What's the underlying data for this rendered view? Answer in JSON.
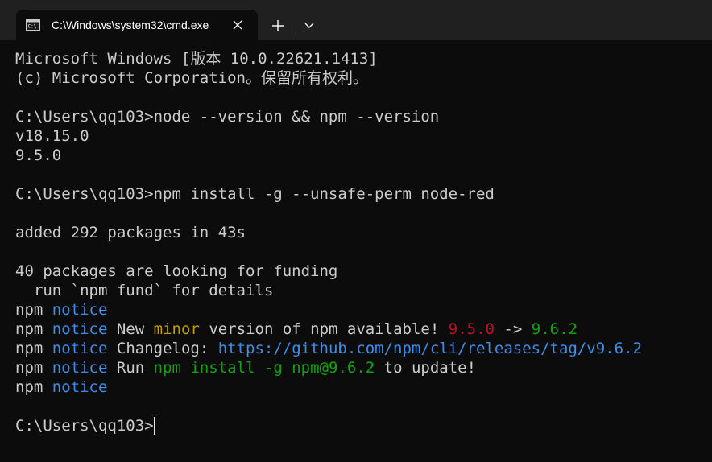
{
  "colors": {
    "background": "#0c0c0c",
    "tabbar": "#202020",
    "text": "#cccccc",
    "blue": "#3b8eea",
    "yellow": "#c19c00",
    "red": "#c50f1f",
    "green": "#13a10e"
  },
  "tab": {
    "icon": "cmd-icon",
    "title": "C:\\Windows\\system32\\cmd.exe",
    "close_icon": "close-icon",
    "new_tab_icon": "plus-icon",
    "dropdown_icon": "chevron-down-icon"
  },
  "terminal": {
    "header": {
      "line1": "Microsoft Windows [版本 10.0.22621.1413]",
      "line2": "(c) Microsoft Corporation。保留所有权利。"
    },
    "cmd1": {
      "prompt": "C:\\Users\\qq103>",
      "command": "node --version && npm --version"
    },
    "node_version": "v18.15.0",
    "npm_version": "9.5.0",
    "cmd2": {
      "prompt": "C:\\Users\\qq103>",
      "command": "npm install -g --unsafe-perm node-red"
    },
    "added": "added 292 packages in 43s",
    "funding1": "40 packages are looking for funding",
    "funding2": "  run `npm fund` for details",
    "notices": {
      "npm": "npm",
      "notice": "notice",
      "new_label": "New",
      "minor": "minor",
      "version_text": "version of npm available!",
      "old_version": "9.5.0",
      "arrow": "->",
      "new_version": "9.6.2",
      "changelog_label": "Changelog:",
      "changelog_url": "https://github.com/npm/cli/releases/tag/v9.6.2",
      "run_label": "Run",
      "run_command": "npm install -g npm@9.6.2",
      "run_suffix": "to update!"
    },
    "final_prompt": "C:\\Users\\qq103>"
  }
}
